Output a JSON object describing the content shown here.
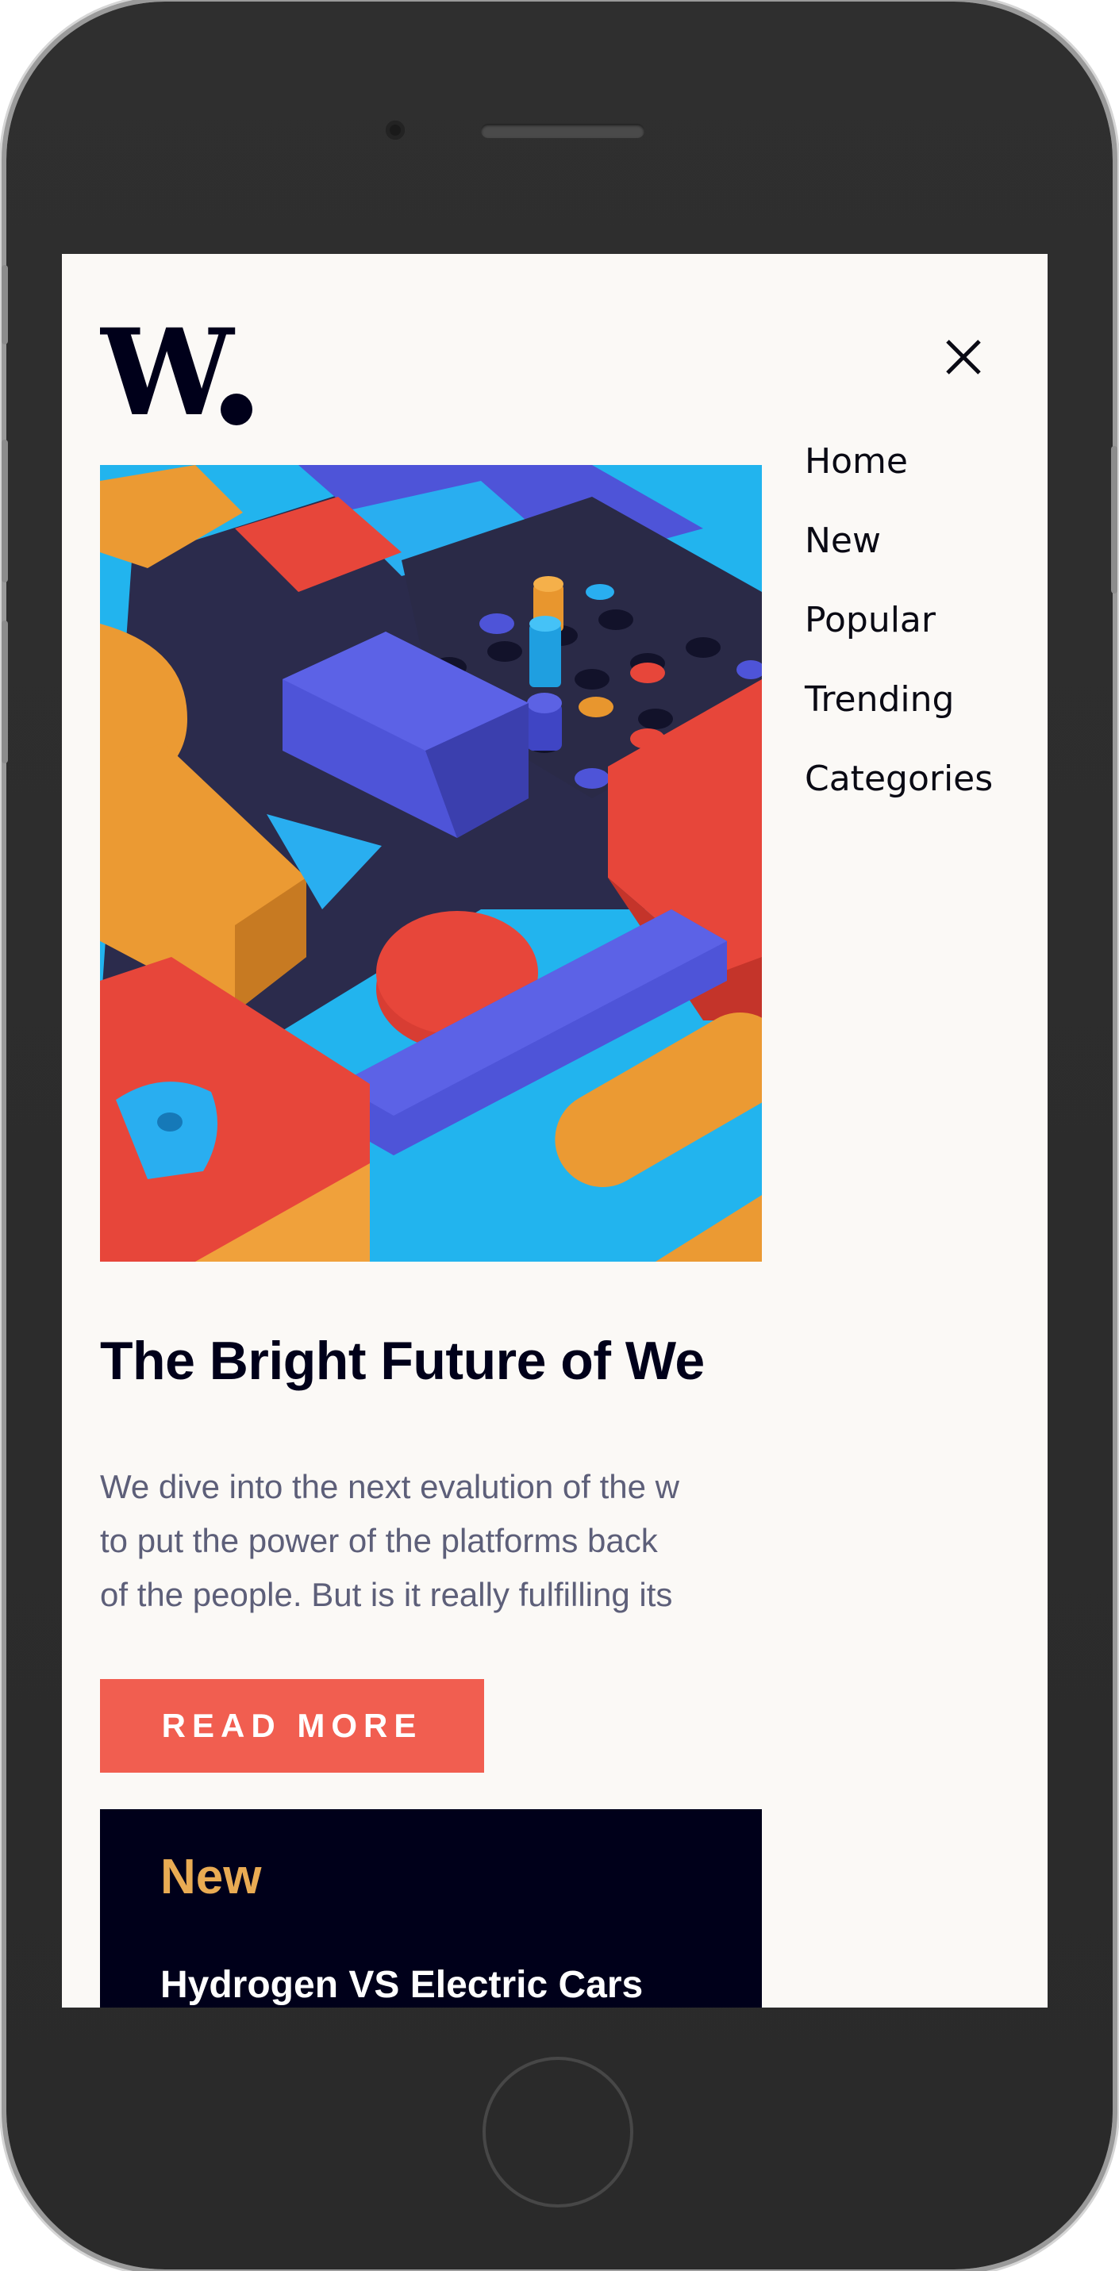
{
  "header": {
    "logo_text": "W."
  },
  "menu": {
    "items": [
      {
        "label": "Home"
      },
      {
        "label": "New"
      },
      {
        "label": "Popular"
      },
      {
        "label": "Trending"
      },
      {
        "label": "Categories"
      }
    ]
  },
  "article": {
    "title": "The Bright Future of We",
    "description_lines": [
      "We dive into the next evalution of the w",
      "to put the power of the platforms back",
      "of the people. But is it really fulfilling its"
    ],
    "read_more_label": "READ MORE"
  },
  "new_section": {
    "heading": "New",
    "first_item": "Hydrogen VS Electric Cars"
  },
  "colors": {
    "screen_bg": "#fbf9f6",
    "dark_navy": "#00001a",
    "accent_red": "#f15e50",
    "accent_orange": "#e9ab53",
    "text_muted": "#5d5f79"
  },
  "icons": [
    "close-icon"
  ]
}
